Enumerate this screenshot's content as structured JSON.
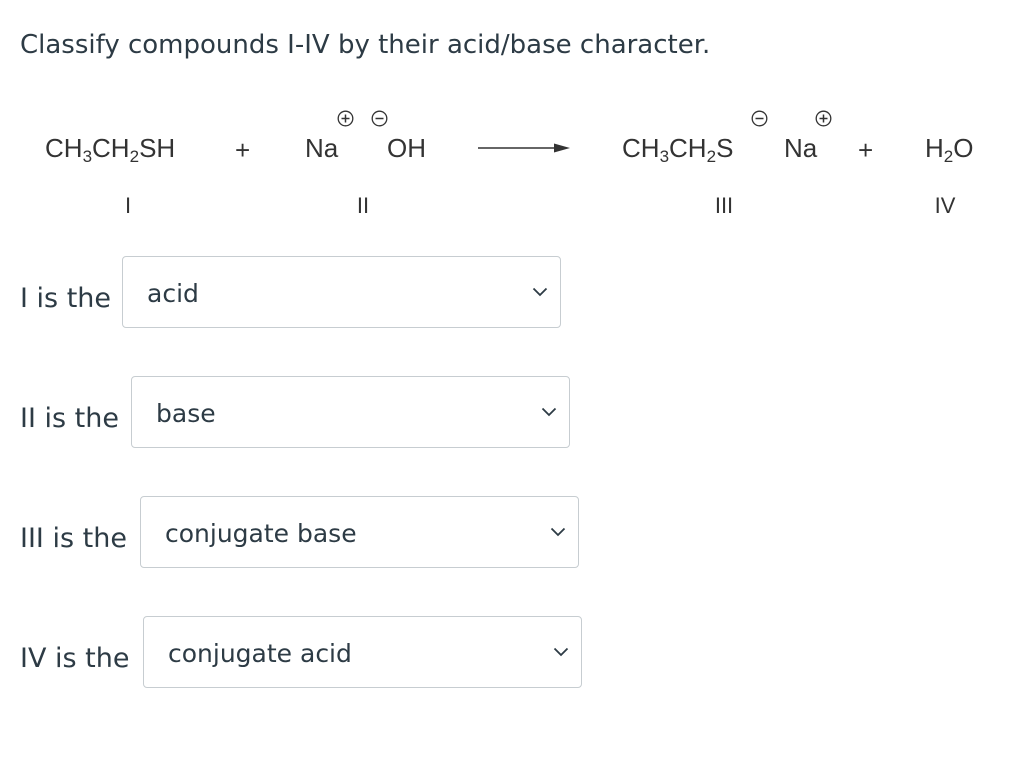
{
  "question": "Classify compounds I-IV by their acid/base character.",
  "reaction": {
    "compound_i": {
      "parts": [
        "CH",
        "3",
        "CH",
        "2",
        "SH"
      ]
    },
    "plus1": "+",
    "sodium_left": "Na",
    "hydroxide": "OH",
    "compound_iii": {
      "parts": [
        "CH",
        "3",
        "CH",
        "2",
        "S"
      ]
    },
    "sodium_right": "Na",
    "plus2": "+",
    "compound_iv": {
      "parts": [
        "H",
        "2",
        "O"
      ]
    },
    "numerals": [
      "I",
      "II",
      "III",
      "IV"
    ]
  },
  "rows": [
    {
      "label": "I is the",
      "value": "acid"
    },
    {
      "label": "II is the",
      "value": "base"
    },
    {
      "label": "III is the",
      "value": "conjugate base"
    },
    {
      "label": "IV is the",
      "value": "conjugate acid"
    }
  ]
}
